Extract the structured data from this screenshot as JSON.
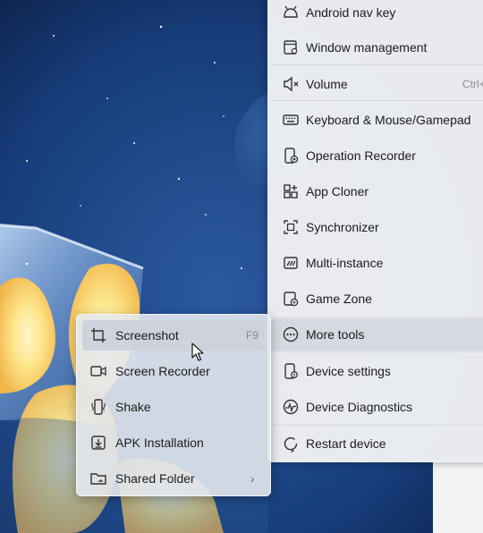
{
  "menu": {
    "items": [
      {
        "label": "Android nav key",
        "icon": "android-icon"
      },
      {
        "label": "Window management",
        "icon": "window-management-icon"
      },
      {
        "label": "Volume",
        "icon": "volume-icon",
        "shortcut": "Ctrl+"
      },
      {
        "label": "Keyboard & Mouse/Gamepad",
        "icon": "keyboard-icon"
      },
      {
        "label": "Operation Recorder",
        "icon": "operation-recorder-icon"
      },
      {
        "label": "App Cloner",
        "icon": "app-cloner-icon"
      },
      {
        "label": "Synchronizer",
        "icon": "synchronizer-icon"
      },
      {
        "label": "Multi-instance",
        "icon": "multi-instance-icon"
      },
      {
        "label": "Game Zone",
        "icon": "game-zone-icon"
      },
      {
        "label": "More tools",
        "icon": "more-tools-icon"
      },
      {
        "label": "Device settings",
        "icon": "device-settings-icon"
      },
      {
        "label": "Device Diagnostics",
        "icon": "device-diagnostics-icon"
      },
      {
        "label": "Restart device",
        "icon": "restart-icon"
      }
    ]
  },
  "submenu": {
    "items": [
      {
        "label": "Screenshot",
        "icon": "crop-screenshot-icon",
        "shortcut": "F9"
      },
      {
        "label": "Screen Recorder",
        "icon": "video-camera-icon"
      },
      {
        "label": "Shake",
        "icon": "shake-icon"
      },
      {
        "label": "APK Installation",
        "icon": "apk-install-icon"
      },
      {
        "label": "Shared Folder",
        "icon": "shared-folder-icon",
        "chevron": "›"
      }
    ]
  },
  "colors": {
    "background": "#0c2148",
    "menu_bg": "#f0f1f4",
    "highlight": "#d4d7de",
    "text": "#1c1c1c",
    "shortcut_text": "#8a8a8a"
  }
}
